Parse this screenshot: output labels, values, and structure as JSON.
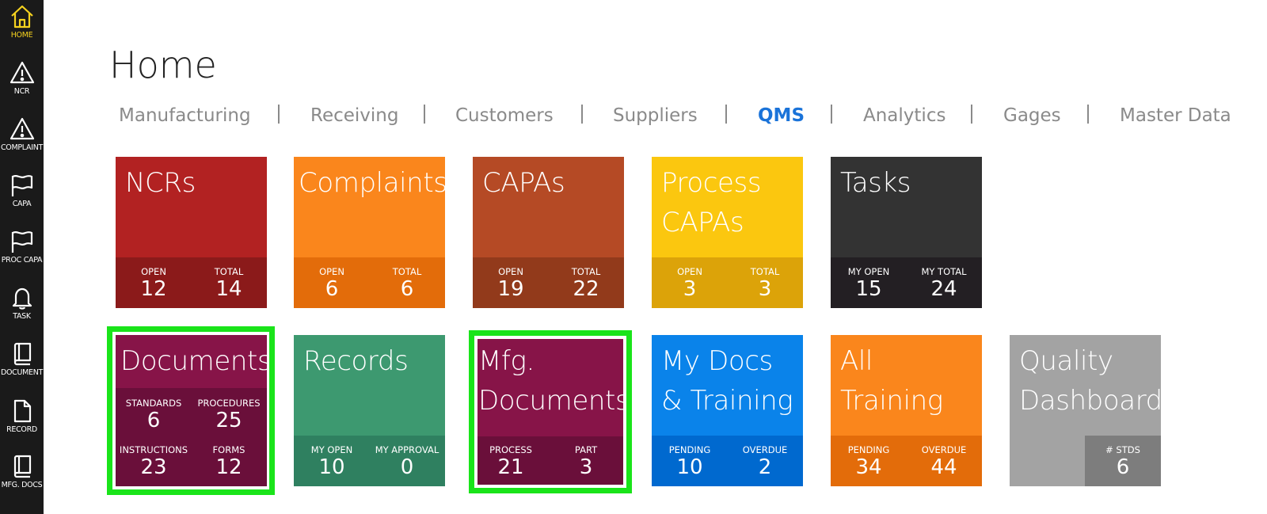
{
  "sidebar": {
    "items": [
      {
        "label": "HOME",
        "icon": "home-icon",
        "active": true
      },
      {
        "label": "NCR",
        "icon": "warning-icon"
      },
      {
        "label": "COMPLAINT",
        "icon": "warning-icon"
      },
      {
        "label": "CAPA",
        "icon": "flag-icon"
      },
      {
        "label": "PROC CAPA",
        "icon": "flag-icon"
      },
      {
        "label": "TASK",
        "icon": "bell-icon"
      },
      {
        "label": "DOCUMENT",
        "icon": "book-icon"
      },
      {
        "label": "RECORD",
        "icon": "file-icon"
      },
      {
        "label": "MFG. DOCS",
        "icon": "book-icon"
      }
    ]
  },
  "page": {
    "title": "Home"
  },
  "tabs": [
    {
      "label": "Manufacturing"
    },
    {
      "label": "Receiving"
    },
    {
      "label": "Customers"
    },
    {
      "label": "Suppliers"
    },
    {
      "label": "QMS",
      "active": true
    },
    {
      "label": "Analytics"
    },
    {
      "label": "Gages"
    },
    {
      "label": "Master Data"
    }
  ],
  "tiles": {
    "ncrs": {
      "title": "NCRs",
      "color": "#b22222",
      "strip_color": "#8b1a1a",
      "stats": [
        {
          "label": "OPEN",
          "value": "12"
        },
        {
          "label": "TOTAL",
          "value": "14"
        }
      ]
    },
    "complaints": {
      "title": "Complaints",
      "color": "#fa861c",
      "strip_color": "#e36c0a",
      "stats": [
        {
          "label": "OPEN",
          "value": "6"
        },
        {
          "label": "TOTAL",
          "value": "6"
        }
      ]
    },
    "capas": {
      "title": "CAPAs",
      "color": "#b54a25",
      "strip_color": "#923a1b",
      "stats": [
        {
          "label": "OPEN",
          "value": "19"
        },
        {
          "label": "TOTAL",
          "value": "22"
        }
      ]
    },
    "process_capas": {
      "title_line1": "Process",
      "title_line2": "CAPAs",
      "color": "#fbc70f",
      "strip_color": "#dca309",
      "stats": [
        {
          "label": "OPEN",
          "value": "3"
        },
        {
          "label": "TOTAL",
          "value": "3"
        }
      ]
    },
    "tasks": {
      "title": "Tasks",
      "color": "#333333",
      "strip_color": "#231f23",
      "stats": [
        {
          "label": "MY OPEN",
          "value": "15"
        },
        {
          "label": "MY TOTAL",
          "value": "24"
        }
      ]
    },
    "documents": {
      "title": "Documents",
      "color": "#871448",
      "strip_color": "#6a0f3a",
      "stats": [
        {
          "label": "STANDARDS",
          "value": "6"
        },
        {
          "label": "PROCEDURES",
          "value": "25"
        },
        {
          "label": "INSTRUCTIONS",
          "value": "23"
        },
        {
          "label": "FORMS",
          "value": "12"
        }
      ]
    },
    "records": {
      "title": "Records",
      "color": "#3d9970",
      "strip_color": "#2f8060",
      "stats": [
        {
          "label": "MY OPEN",
          "value": "10"
        },
        {
          "label": "MY APPROVAL",
          "value": "0"
        }
      ]
    },
    "mfg_documents": {
      "title_line1": "Mfg.",
      "title_line2": "Documents",
      "color": "#871448",
      "strip_color": "#6a0f3a",
      "stats": [
        {
          "label": "PROCESS",
          "value": "21"
        },
        {
          "label": "PART",
          "value": "3"
        }
      ]
    },
    "my_docs": {
      "title_line1": "My Docs",
      "title_line2": "& Training",
      "color": "#0a83ea",
      "strip_color": "#0069cf",
      "stats": [
        {
          "label": "PENDING",
          "value": "10"
        },
        {
          "label": "OVERDUE",
          "value": "2"
        }
      ]
    },
    "all_training": {
      "title_line1": "All",
      "title_line2": "Training",
      "color": "#fa861c",
      "strip_color": "#e36c0a",
      "stats": [
        {
          "label": "PENDING",
          "value": "34"
        },
        {
          "label": "OVERDUE",
          "value": "44"
        }
      ]
    },
    "quality_dashboard": {
      "title_line1": "Quality",
      "title_line2": "Dashboard",
      "color": "#a3a3a3",
      "strip_color": "#7d7d7d",
      "stats": [
        {
          "label": "# STDS",
          "value": "6"
        }
      ]
    }
  },
  "colors": {
    "highlight": "#1ae41a",
    "active_tab": "#1a73d9",
    "sidebar_active": "#f5d21f"
  }
}
